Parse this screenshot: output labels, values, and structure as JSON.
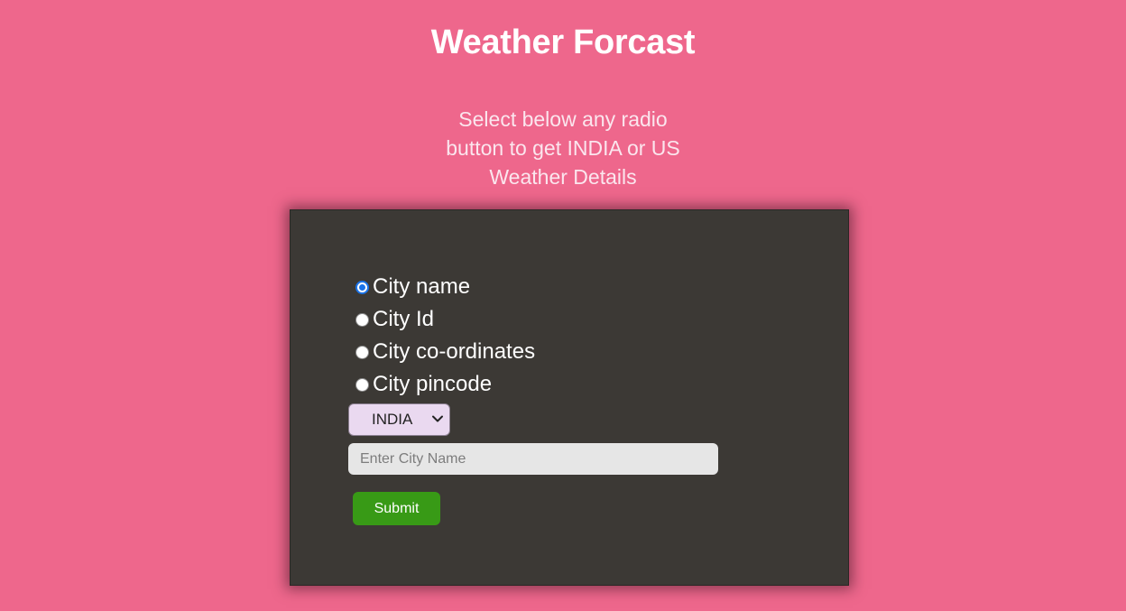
{
  "header": {
    "title": "Weather Forcast",
    "subtitle": "Select below any radio button to get INDIA or US Weather Details"
  },
  "form": {
    "radio_options": [
      {
        "label": "City name",
        "checked": true
      },
      {
        "label": "City Id",
        "checked": false
      },
      {
        "label": "City co-ordinates",
        "checked": false
      },
      {
        "label": "City pincode",
        "checked": false
      }
    ],
    "country_select": {
      "selected": "INDIA"
    },
    "city_input": {
      "value": "",
      "placeholder": "Enter City Name"
    },
    "submit_label": "Submit"
  },
  "colors": {
    "background": "#ee678c",
    "panel": "#3c3935",
    "submit": "#389a16",
    "select_bg": "#ead9f0",
    "radio_checked": "#1a73e8"
  }
}
